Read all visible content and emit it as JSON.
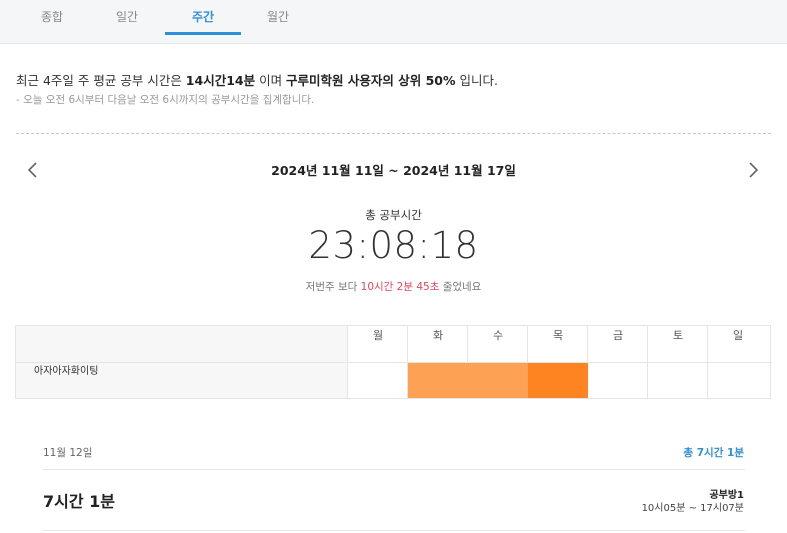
{
  "tabs": [
    {
      "label": "종합"
    },
    {
      "label": "일간"
    },
    {
      "label": "주간"
    },
    {
      "label": "월간"
    }
  ],
  "summary": {
    "prefix": "최근 4주일 주 평균 공부 시간은 ",
    "avg_time": "14시간14분",
    "middle": " 이며 ",
    "rank_text": "구루미학원 사용자의 상위 50%",
    "suffix": " 입니다.",
    "note": "- 오늘 오전 6시부터 다음날 오전 6시까지의 공부시간을 집계합니다."
  },
  "week": {
    "date_range": "2024년 11월 11일 ~ 2024년 11월 17일",
    "total_label": "총 공부시간",
    "total_time": "23:08:18",
    "compare_prefix": "저번주 보다 ",
    "compare_diff": "10시간 2분 45초",
    "compare_suffix": " 줄었네요"
  },
  "grid": {
    "room_name": "아자아자화이팅",
    "days": [
      {
        "label": "월",
        "color": ""
      },
      {
        "label": "화",
        "color": "#fda155"
      },
      {
        "label": "수",
        "color": "#fda155"
      },
      {
        "label": "목",
        "color": "#fd8421"
      },
      {
        "label": "금",
        "color": ""
      },
      {
        "label": "토",
        "color": ""
      },
      {
        "label": "일",
        "color": ""
      }
    ]
  },
  "detail": {
    "date": "11월 12일",
    "total": "총 7시간 1분",
    "duration": "7시간 1분",
    "room": "공부방1",
    "time_range": "10시05분 ~ 17시07분"
  },
  "colors": {
    "accent": "#2f8fd8",
    "highlight": "#e8455b"
  }
}
